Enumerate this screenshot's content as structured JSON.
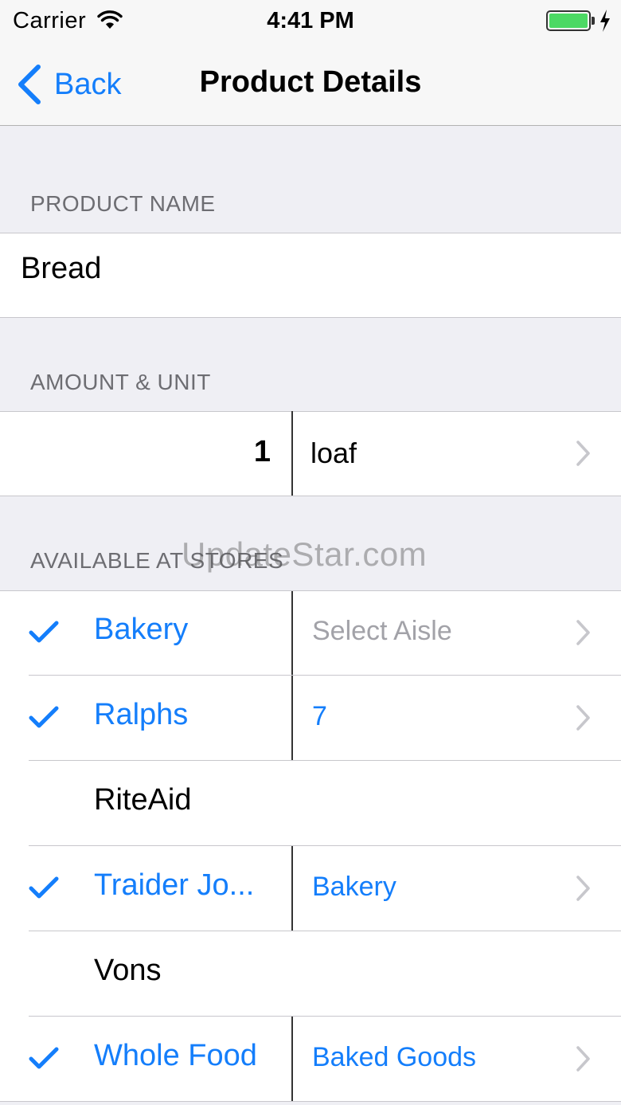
{
  "status_bar": {
    "carrier": "Carrier",
    "time": "4:41 PM",
    "battery_level": 1.0,
    "battery_color": "#4cd964"
  },
  "nav": {
    "back_label": "Back",
    "title": "Product Details",
    "accent": "#147efb"
  },
  "sections": {
    "product_name_header": "PRODUCT NAME",
    "amount_unit_header": "AMOUNT & UNIT",
    "stores_header": "AVAILABLE AT STORES"
  },
  "product": {
    "name": "Bread",
    "amount": "1",
    "unit": "loaf"
  },
  "stores": [
    {
      "name": "Bakery",
      "checked": true,
      "aisle": "Select Aisle",
      "aisle_style": "placeholder"
    },
    {
      "name": "Ralphs",
      "checked": true,
      "aisle": "7",
      "aisle_style": "value"
    },
    {
      "name": "RiteAid",
      "checked": false,
      "aisle": "",
      "aisle_style": "none"
    },
    {
      "name": "Traider Jo...",
      "checked": true,
      "aisle": "Bakery",
      "aisle_style": "value"
    },
    {
      "name": "Vons",
      "checked": false,
      "aisle": "",
      "aisle_style": "none"
    },
    {
      "name": "Whole Food",
      "checked": true,
      "aisle": "Baked Goods",
      "aisle_style": "value"
    }
  ],
  "watermark": "UpdateStar.com"
}
